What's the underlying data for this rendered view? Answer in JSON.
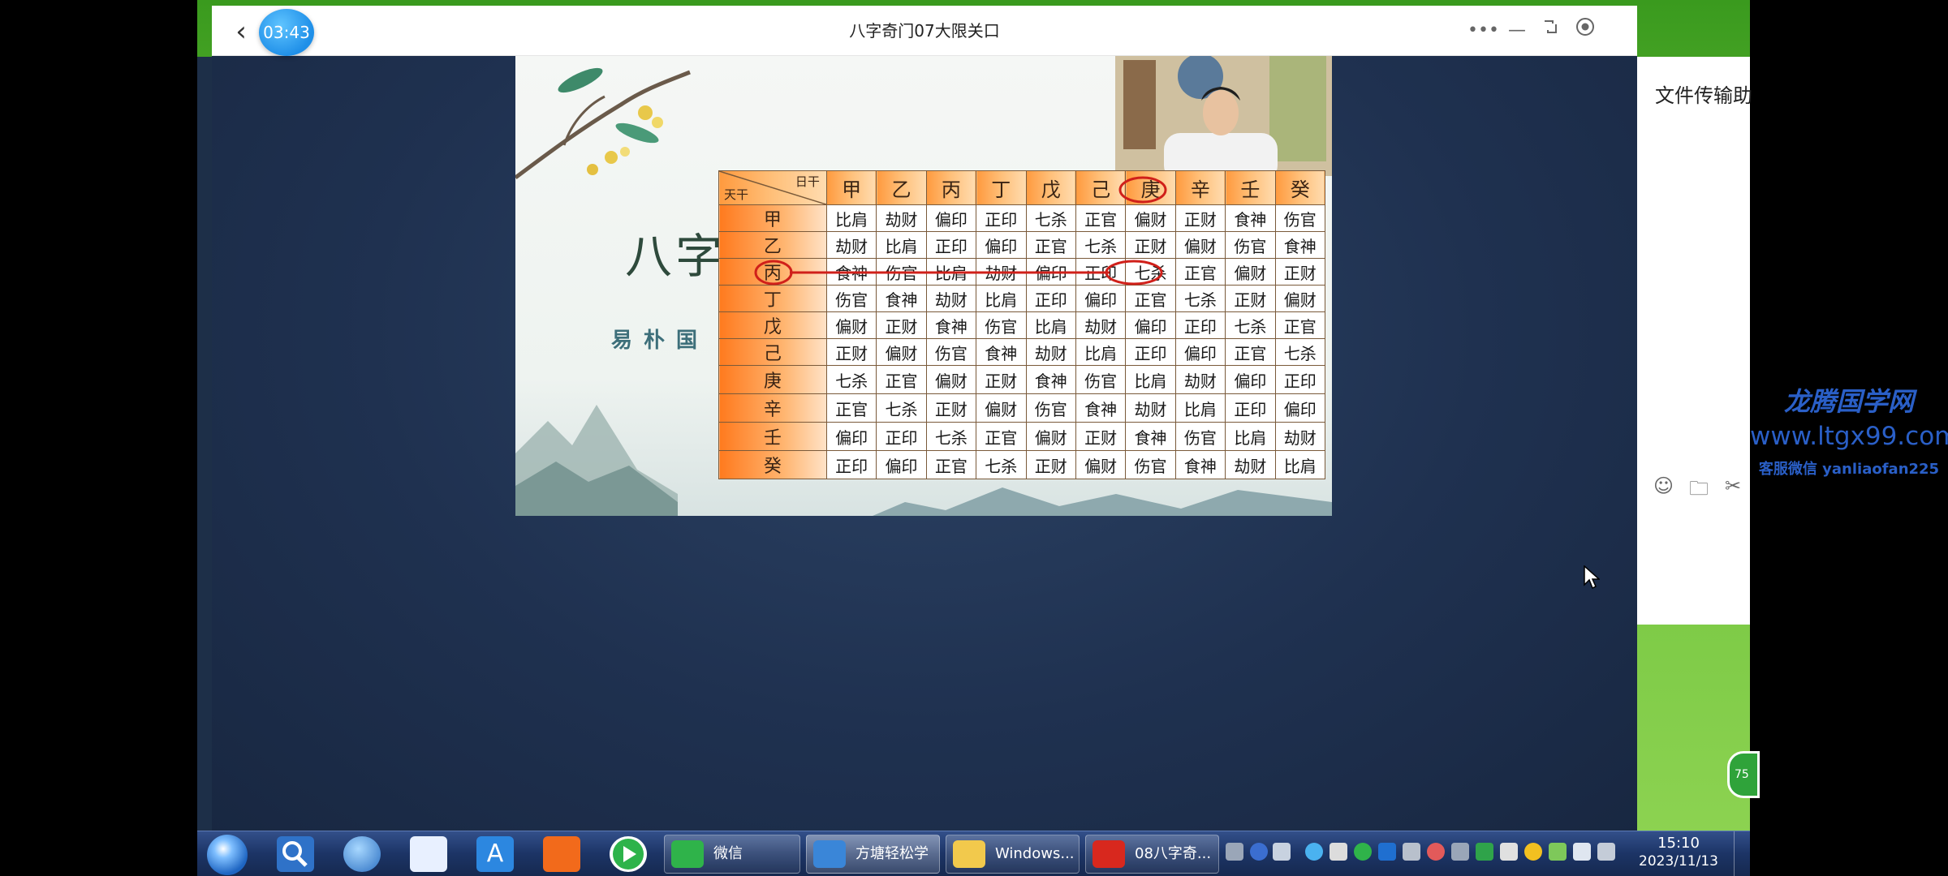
{
  "window": {
    "title": "八字奇门07大限关口",
    "timer": "03:43"
  },
  "slide": {
    "big_char": "八字",
    "subtitle": "易朴国"
  },
  "table": {
    "corner_top": "日干",
    "corner_bottom": "天干",
    "columns": [
      "甲",
      "乙",
      "丙",
      "丁",
      "戊",
      "己",
      "庚",
      "辛",
      "壬",
      "癸"
    ],
    "rows": [
      {
        "stem": "甲",
        "cells": [
          "比肩",
          "劫财",
          "偏印",
          "正印",
          "七杀",
          "正官",
          "偏财",
          "正财",
          "食神",
          "伤官"
        ]
      },
      {
        "stem": "乙",
        "cells": [
          "劫财",
          "比肩",
          "正印",
          "偏印",
          "正官",
          "七杀",
          "正财",
          "偏财",
          "伤官",
          "食神"
        ]
      },
      {
        "stem": "丙",
        "cells": [
          "食神",
          "伤官",
          "比肩",
          "劫财",
          "偏印",
          "正印",
          "七杀",
          "正官",
          "偏财",
          "正财"
        ]
      },
      {
        "stem": "丁",
        "cells": [
          "伤官",
          "食神",
          "劫财",
          "比肩",
          "正印",
          "偏印",
          "正官",
          "七杀",
          "正财",
          "偏财"
        ]
      },
      {
        "stem": "戊",
        "cells": [
          "偏财",
          "正财",
          "食神",
          "伤官",
          "比肩",
          "劫财",
          "偏印",
          "正印",
          "七杀",
          "正官"
        ]
      },
      {
        "stem": "己",
        "cells": [
          "正财",
          "偏财",
          "伤官",
          "食神",
          "劫财",
          "比肩",
          "正印",
          "偏印",
          "正官",
          "七杀"
        ]
      },
      {
        "stem": "庚",
        "cells": [
          "七杀",
          "正官",
          "偏财",
          "正财",
          "食神",
          "伤官",
          "比肩",
          "劫财",
          "偏印",
          "正印"
        ]
      },
      {
        "stem": "辛",
        "cells": [
          "正官",
          "七杀",
          "正财",
          "偏财",
          "伤官",
          "食神",
          "劫财",
          "比肩",
          "正印",
          "偏印"
        ]
      },
      {
        "stem": "壬",
        "cells": [
          "偏印",
          "正印",
          "七杀",
          "正官",
          "偏财",
          "正财",
          "食神",
          "伤官",
          "比肩",
          "劫财"
        ]
      },
      {
        "stem": "癸",
        "cells": [
          "正印",
          "偏印",
          "正官",
          "七杀",
          "正财",
          "偏财",
          "伤官",
          "食神",
          "劫财",
          "比肩"
        ]
      }
    ]
  },
  "right_panel": {
    "title": "文件传输助"
  },
  "watermark": {
    "title": "龙腾国学网",
    "url": "www.ltgx99.com",
    "wechat": "客服微信 yanliaofan225"
  },
  "taskbar": {
    "tasks": [
      {
        "label": "微信",
        "icon": "wechat-icon"
      },
      {
        "label": "方塘轻松学",
        "icon": "app-icon"
      },
      {
        "label": "Windows...",
        "icon": "folder-icon"
      },
      {
        "label": "08八字奇...",
        "icon": "wps-icon"
      }
    ],
    "clock_time": "15:10",
    "clock_date": "2023/11/13"
  },
  "badge": "75",
  "colors": {
    "accent": "#1f8fe8",
    "table_header": "#ff9a3e",
    "annotation": "#d0201a",
    "watermark": "#2a5fc7"
  }
}
